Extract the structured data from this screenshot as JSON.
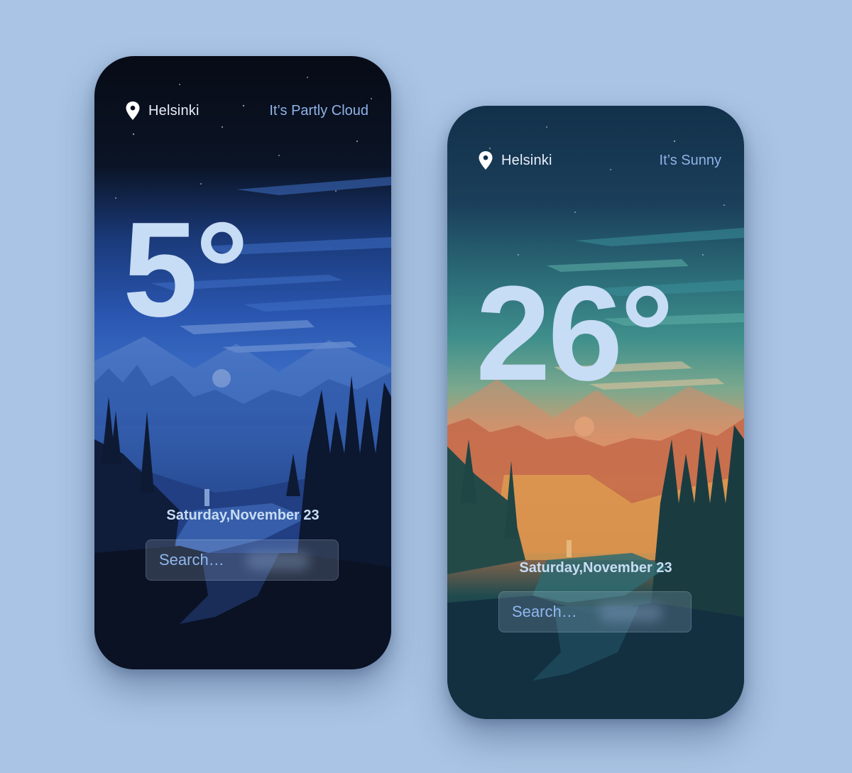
{
  "colors": {
    "background": "#a9c4e4",
    "temperature": "#c7dcf5",
    "condition_text": "#8fb3e8"
  },
  "screens": [
    {
      "theme": "night",
      "city": "Helsinki",
      "condition": "It’s Partly Cloud",
      "temperature": "5°",
      "date": "Saturday,November 23",
      "search_placeholder": "Search…",
      "icons": {
        "location": "location-pin-icon"
      }
    },
    {
      "theme": "sunset",
      "city": "Helsinki",
      "condition": "It’s Sunny",
      "temperature": "26°",
      "date": "Saturday,November 23",
      "search_placeholder": "Search…",
      "icons": {
        "location": "location-pin-icon"
      }
    }
  ]
}
